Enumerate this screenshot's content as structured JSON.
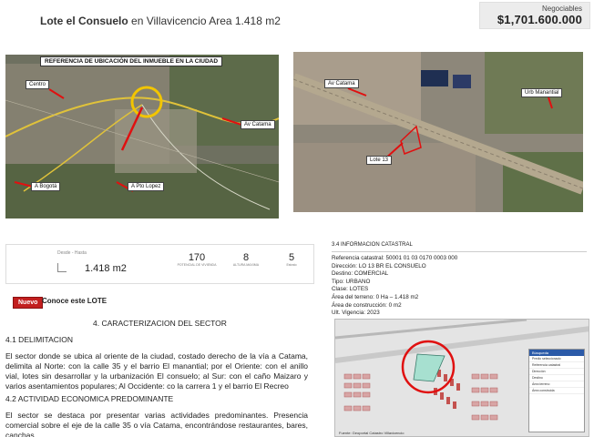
{
  "header": {
    "title_bold": "Lote el Consuelo",
    "title_rest": " en Villavicencio Area 1.418 m2",
    "price_label": "Negociables",
    "price_value": "$1,701.600.000"
  },
  "map1": {
    "caption": "REFERENCIA DE UBICACIÓN DEL INMUEBLE EN LA CIUDAD",
    "labels": {
      "centro": "Centro",
      "av_catama": "Av Catama",
      "a_bogota": "A Bogotá",
      "a_pto_lopez": "A Pto Lopez"
    }
  },
  "map2": {
    "labels": {
      "av_catama": "Av Catama",
      "urb_manantial": "Urb Manantial",
      "lote": "Lote 13"
    }
  },
  "stats": {
    "range_label": "Desde - Hasta",
    "area": "1.418 m2",
    "items": [
      {
        "num": "170",
        "caption": "POTENCIAL DE VIVIENDA"
      },
      {
        "num": "8",
        "caption": "ALTURA MAXIMA"
      },
      {
        "num": "5",
        "caption": "Estrato"
      }
    ]
  },
  "nuevo": {
    "badge": "Nuevo",
    "text": "Conoce este LOTE"
  },
  "sections": {
    "main_title": "4.  CARACTERIZACION DEL SECTOR",
    "delim_title": "4.1 DELIMITACION",
    "delim_text": "El sector donde se ubica al oriente de la ciudad, costado derecho de la vía a Catama, delimita al Norte: con la calle 35 y el barrio El manantial; por el Oriente: con el anillo vial, lotes sin desarrollar y la urbanización El consuelo; al Sur: con el caño Maizaro y varios asentamientos populares; Al Occidente: co la carrera 1 y el barrio El Recreo",
    "actividad_title": "4.2 ACTIVIDAD ECONOMICA PREDOMINANTE",
    "actividad_text": "El sector se destaca por presentar varias actividades predominantes. Presencia comercial sobre el eje de la calle 35 o vía Catama, encontrándose restaurantes, bares, canchas"
  },
  "catastral": {
    "title": "3.4 INFORMACION CATASTRAL",
    "lines": [
      "Referencia catastral: 50001 01 03 0170 0003 000",
      "Dirección: LO 13 BR EL CONSUELO",
      "Destino: COMERCIAL",
      "Tipo: URBANO",
      "Clase: LOTES",
      "Área del terreno: 0 Ha – 1.418 m2",
      "Área de construcción: 0 m2",
      "Ult. Vigencia: 2023"
    ]
  },
  "map3": {
    "panel_title": "Búsqueda",
    "panel_rows": [
      "Predio seleccionado",
      "Referencia catastral",
      "Dirección",
      "Destino",
      "Área terreno",
      "Área construida"
    ],
    "credit": "Fuente: Geoportal Catastro Villavicencio"
  },
  "colors": {
    "badge_red": "#c21f1f",
    "highlight_yellow": "#f2c500",
    "marker_red": "#e01010",
    "panel_blue": "#2b5aa8"
  }
}
